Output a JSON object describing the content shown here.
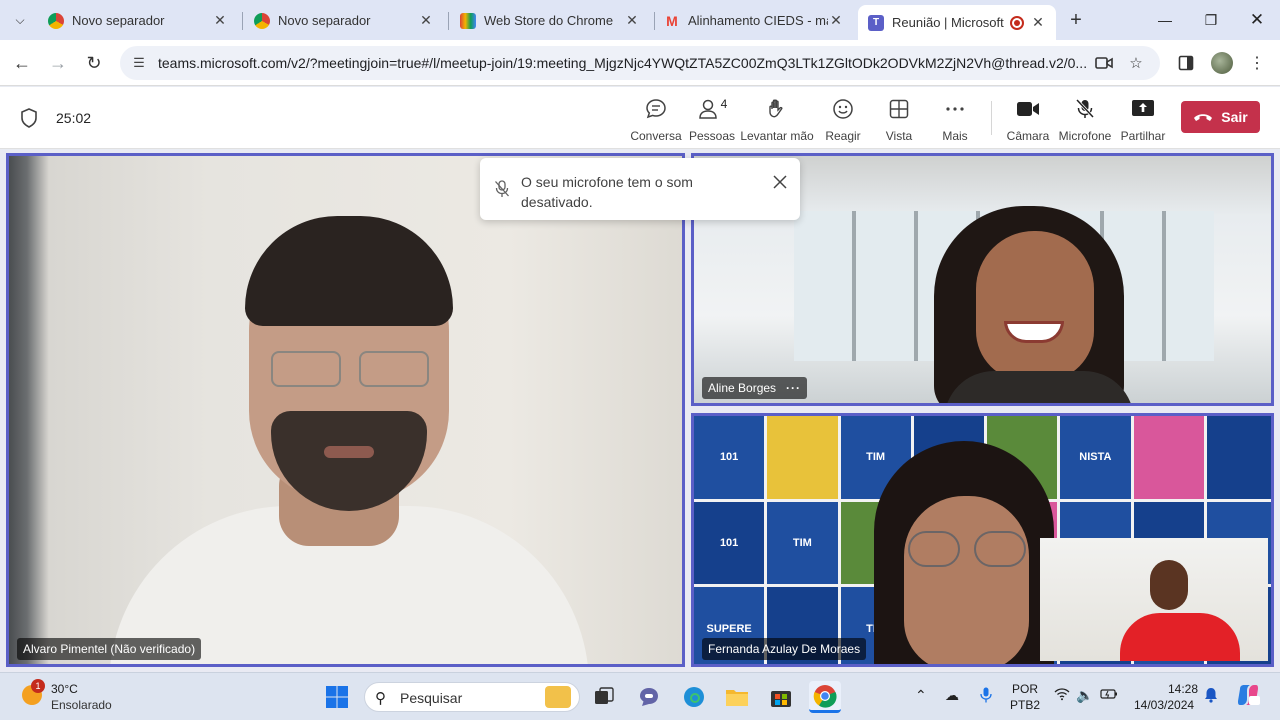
{
  "browser": {
    "tabs": [
      {
        "label": "Novo separador",
        "favicon": "chrome-icon"
      },
      {
        "label": "Novo separador",
        "favicon": "chrome-icon"
      },
      {
        "label": "Web Store do Chrome",
        "favicon": "chrome-web-store-icon"
      },
      {
        "label": "Alinhamento CIEDS - mai",
        "favicon": "gmail-icon"
      },
      {
        "label": "Reunião | Microsoft T",
        "favicon": "teams-icon",
        "active": true
      }
    ],
    "url": "teams.microsoft.com/v2/?meetingjoin=true#/l/meetup-join/19:meeting_MjgzNjc4YWQtZTA5ZC00ZmQ3LTk1ZGltODk2ODVkM2ZjN2Vh@thread.v2/0..."
  },
  "meeting": {
    "timer": "25:02",
    "controls": [
      {
        "label": "Conversa",
        "icon": "chat-icon"
      },
      {
        "label": "Pessoas",
        "icon": "people-icon",
        "badge": "4"
      },
      {
        "label": "Levantar mão",
        "icon": "raise-hand-icon"
      },
      {
        "label": "Reagir",
        "icon": "react-icon"
      },
      {
        "label": "Vista",
        "icon": "view-icon"
      },
      {
        "label": "Mais",
        "icon": "more-icon"
      },
      {
        "label": "Câmara",
        "icon": "camera-icon"
      },
      {
        "label": "Microfone",
        "icon": "mic-off-icon"
      },
      {
        "label": "Partilhar",
        "icon": "share-icon"
      }
    ],
    "leave_label": "Sair",
    "toast_message": "O seu microfone tem o som desativado.",
    "participants": {
      "left": "Alvaro Pimentel (Não verificado)",
      "top_right": "Aline Borges",
      "bottom_right": "Fernanda Azulay De Moraes"
    },
    "accent_color": "#5b5fc7",
    "leave_color": "#c4314b"
  },
  "taskbar": {
    "weather_temp": "30°C",
    "weather_desc": "Ensolarado",
    "weather_badge": "1",
    "search_placeholder": "Pesquisar",
    "lang_line1": "POR",
    "lang_line2": "PTB2",
    "time": "14:28",
    "date": "14/03/2024"
  }
}
